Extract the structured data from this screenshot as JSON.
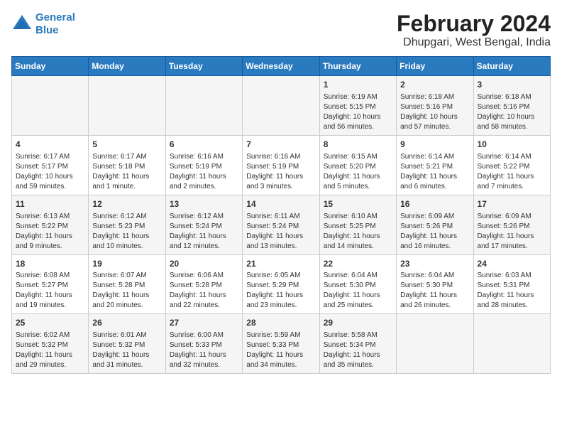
{
  "header": {
    "logo_line1": "General",
    "logo_line2": "Blue",
    "main_title": "February 2024",
    "subtitle": "Dhupgari, West Bengal, India"
  },
  "weekdays": [
    "Sunday",
    "Monday",
    "Tuesday",
    "Wednesday",
    "Thursday",
    "Friday",
    "Saturday"
  ],
  "weeks": [
    [
      {
        "day": "",
        "info": ""
      },
      {
        "day": "",
        "info": ""
      },
      {
        "day": "",
        "info": ""
      },
      {
        "day": "",
        "info": ""
      },
      {
        "day": "1",
        "info": "Sunrise: 6:19 AM\nSunset: 5:15 PM\nDaylight: 10 hours\nand 56 minutes."
      },
      {
        "day": "2",
        "info": "Sunrise: 6:18 AM\nSunset: 5:16 PM\nDaylight: 10 hours\nand 57 minutes."
      },
      {
        "day": "3",
        "info": "Sunrise: 6:18 AM\nSunset: 5:16 PM\nDaylight: 10 hours\nand 58 minutes."
      }
    ],
    [
      {
        "day": "4",
        "info": "Sunrise: 6:17 AM\nSunset: 5:17 PM\nDaylight: 10 hours\nand 59 minutes."
      },
      {
        "day": "5",
        "info": "Sunrise: 6:17 AM\nSunset: 5:18 PM\nDaylight: 11 hours\nand 1 minute."
      },
      {
        "day": "6",
        "info": "Sunrise: 6:16 AM\nSunset: 5:19 PM\nDaylight: 11 hours\nand 2 minutes."
      },
      {
        "day": "7",
        "info": "Sunrise: 6:16 AM\nSunset: 5:19 PM\nDaylight: 11 hours\nand 3 minutes."
      },
      {
        "day": "8",
        "info": "Sunrise: 6:15 AM\nSunset: 5:20 PM\nDaylight: 11 hours\nand 5 minutes."
      },
      {
        "day": "9",
        "info": "Sunrise: 6:14 AM\nSunset: 5:21 PM\nDaylight: 11 hours\nand 6 minutes."
      },
      {
        "day": "10",
        "info": "Sunrise: 6:14 AM\nSunset: 5:22 PM\nDaylight: 11 hours\nand 7 minutes."
      }
    ],
    [
      {
        "day": "11",
        "info": "Sunrise: 6:13 AM\nSunset: 5:22 PM\nDaylight: 11 hours\nand 9 minutes."
      },
      {
        "day": "12",
        "info": "Sunrise: 6:12 AM\nSunset: 5:23 PM\nDaylight: 11 hours\nand 10 minutes."
      },
      {
        "day": "13",
        "info": "Sunrise: 6:12 AM\nSunset: 5:24 PM\nDaylight: 11 hours\nand 12 minutes."
      },
      {
        "day": "14",
        "info": "Sunrise: 6:11 AM\nSunset: 5:24 PM\nDaylight: 11 hours\nand 13 minutes."
      },
      {
        "day": "15",
        "info": "Sunrise: 6:10 AM\nSunset: 5:25 PM\nDaylight: 11 hours\nand 14 minutes."
      },
      {
        "day": "16",
        "info": "Sunrise: 6:09 AM\nSunset: 5:26 PM\nDaylight: 11 hours\nand 16 minutes."
      },
      {
        "day": "17",
        "info": "Sunrise: 6:09 AM\nSunset: 5:26 PM\nDaylight: 11 hours\nand 17 minutes."
      }
    ],
    [
      {
        "day": "18",
        "info": "Sunrise: 6:08 AM\nSunset: 5:27 PM\nDaylight: 11 hours\nand 19 minutes."
      },
      {
        "day": "19",
        "info": "Sunrise: 6:07 AM\nSunset: 5:28 PM\nDaylight: 11 hours\nand 20 minutes."
      },
      {
        "day": "20",
        "info": "Sunrise: 6:06 AM\nSunset: 5:28 PM\nDaylight: 11 hours\nand 22 minutes."
      },
      {
        "day": "21",
        "info": "Sunrise: 6:05 AM\nSunset: 5:29 PM\nDaylight: 11 hours\nand 23 minutes."
      },
      {
        "day": "22",
        "info": "Sunrise: 6:04 AM\nSunset: 5:30 PM\nDaylight: 11 hours\nand 25 minutes."
      },
      {
        "day": "23",
        "info": "Sunrise: 6:04 AM\nSunset: 5:30 PM\nDaylight: 11 hours\nand 26 minutes."
      },
      {
        "day": "24",
        "info": "Sunrise: 6:03 AM\nSunset: 5:31 PM\nDaylight: 11 hours\nand 28 minutes."
      }
    ],
    [
      {
        "day": "25",
        "info": "Sunrise: 6:02 AM\nSunset: 5:32 PM\nDaylight: 11 hours\nand 29 minutes."
      },
      {
        "day": "26",
        "info": "Sunrise: 6:01 AM\nSunset: 5:32 PM\nDaylight: 11 hours\nand 31 minutes."
      },
      {
        "day": "27",
        "info": "Sunrise: 6:00 AM\nSunset: 5:33 PM\nDaylight: 11 hours\nand 32 minutes."
      },
      {
        "day": "28",
        "info": "Sunrise: 5:59 AM\nSunset: 5:33 PM\nDaylight: 11 hours\nand 34 minutes."
      },
      {
        "day": "29",
        "info": "Sunrise: 5:58 AM\nSunset: 5:34 PM\nDaylight: 11 hours\nand 35 minutes."
      },
      {
        "day": "",
        "info": ""
      },
      {
        "day": "",
        "info": ""
      }
    ]
  ]
}
